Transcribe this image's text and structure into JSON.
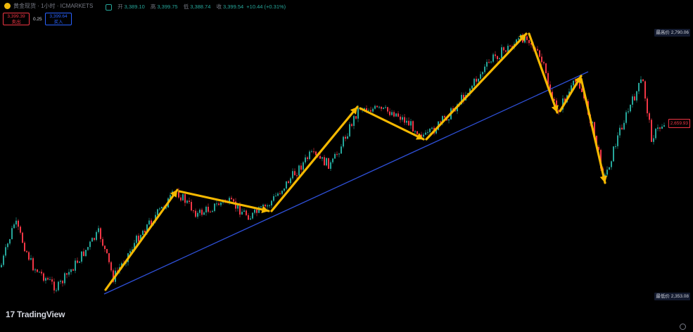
{
  "header": {
    "symbol": "黄金现货 · 1小时 · ICMARKETS",
    "ohlc": [
      {
        "key": "开",
        "value": "3,389.10"
      },
      {
        "key": "高",
        "value": "3,399.75"
      },
      {
        "key": "低",
        "value": "3,388.74"
      },
      {
        "key": "收",
        "value": "3,399.54"
      }
    ],
    "change": "+10.44 (+0.31%)"
  },
  "trade": {
    "sell_price": "3,399.39",
    "sell_label": "卖出",
    "spread": "0.25",
    "buy_price": "3,399.64",
    "buy_label": "买入"
  },
  "price_axis": {
    "high_label": "最高价",
    "high_value": "2,790.06",
    "low_label": "最低价",
    "low_value": "2,353.08",
    "current_value": "2,659.93"
  },
  "branding": {
    "name": "TradingView"
  },
  "colors": {
    "bull": "#26a69a",
    "bear": "#f23645",
    "trendline": "#2e4fd6",
    "arrow": "#f5b800"
  },
  "chart_data": {
    "type": "candlestick",
    "y_range_shown": [
      2353.08,
      2790.06
    ],
    "trend_points": [
      2440,
      2520,
      2500,
      2580,
      2700,
      2680,
      2790,
      2630,
      2700,
      2560,
      2720,
      2659.93
    ]
  }
}
